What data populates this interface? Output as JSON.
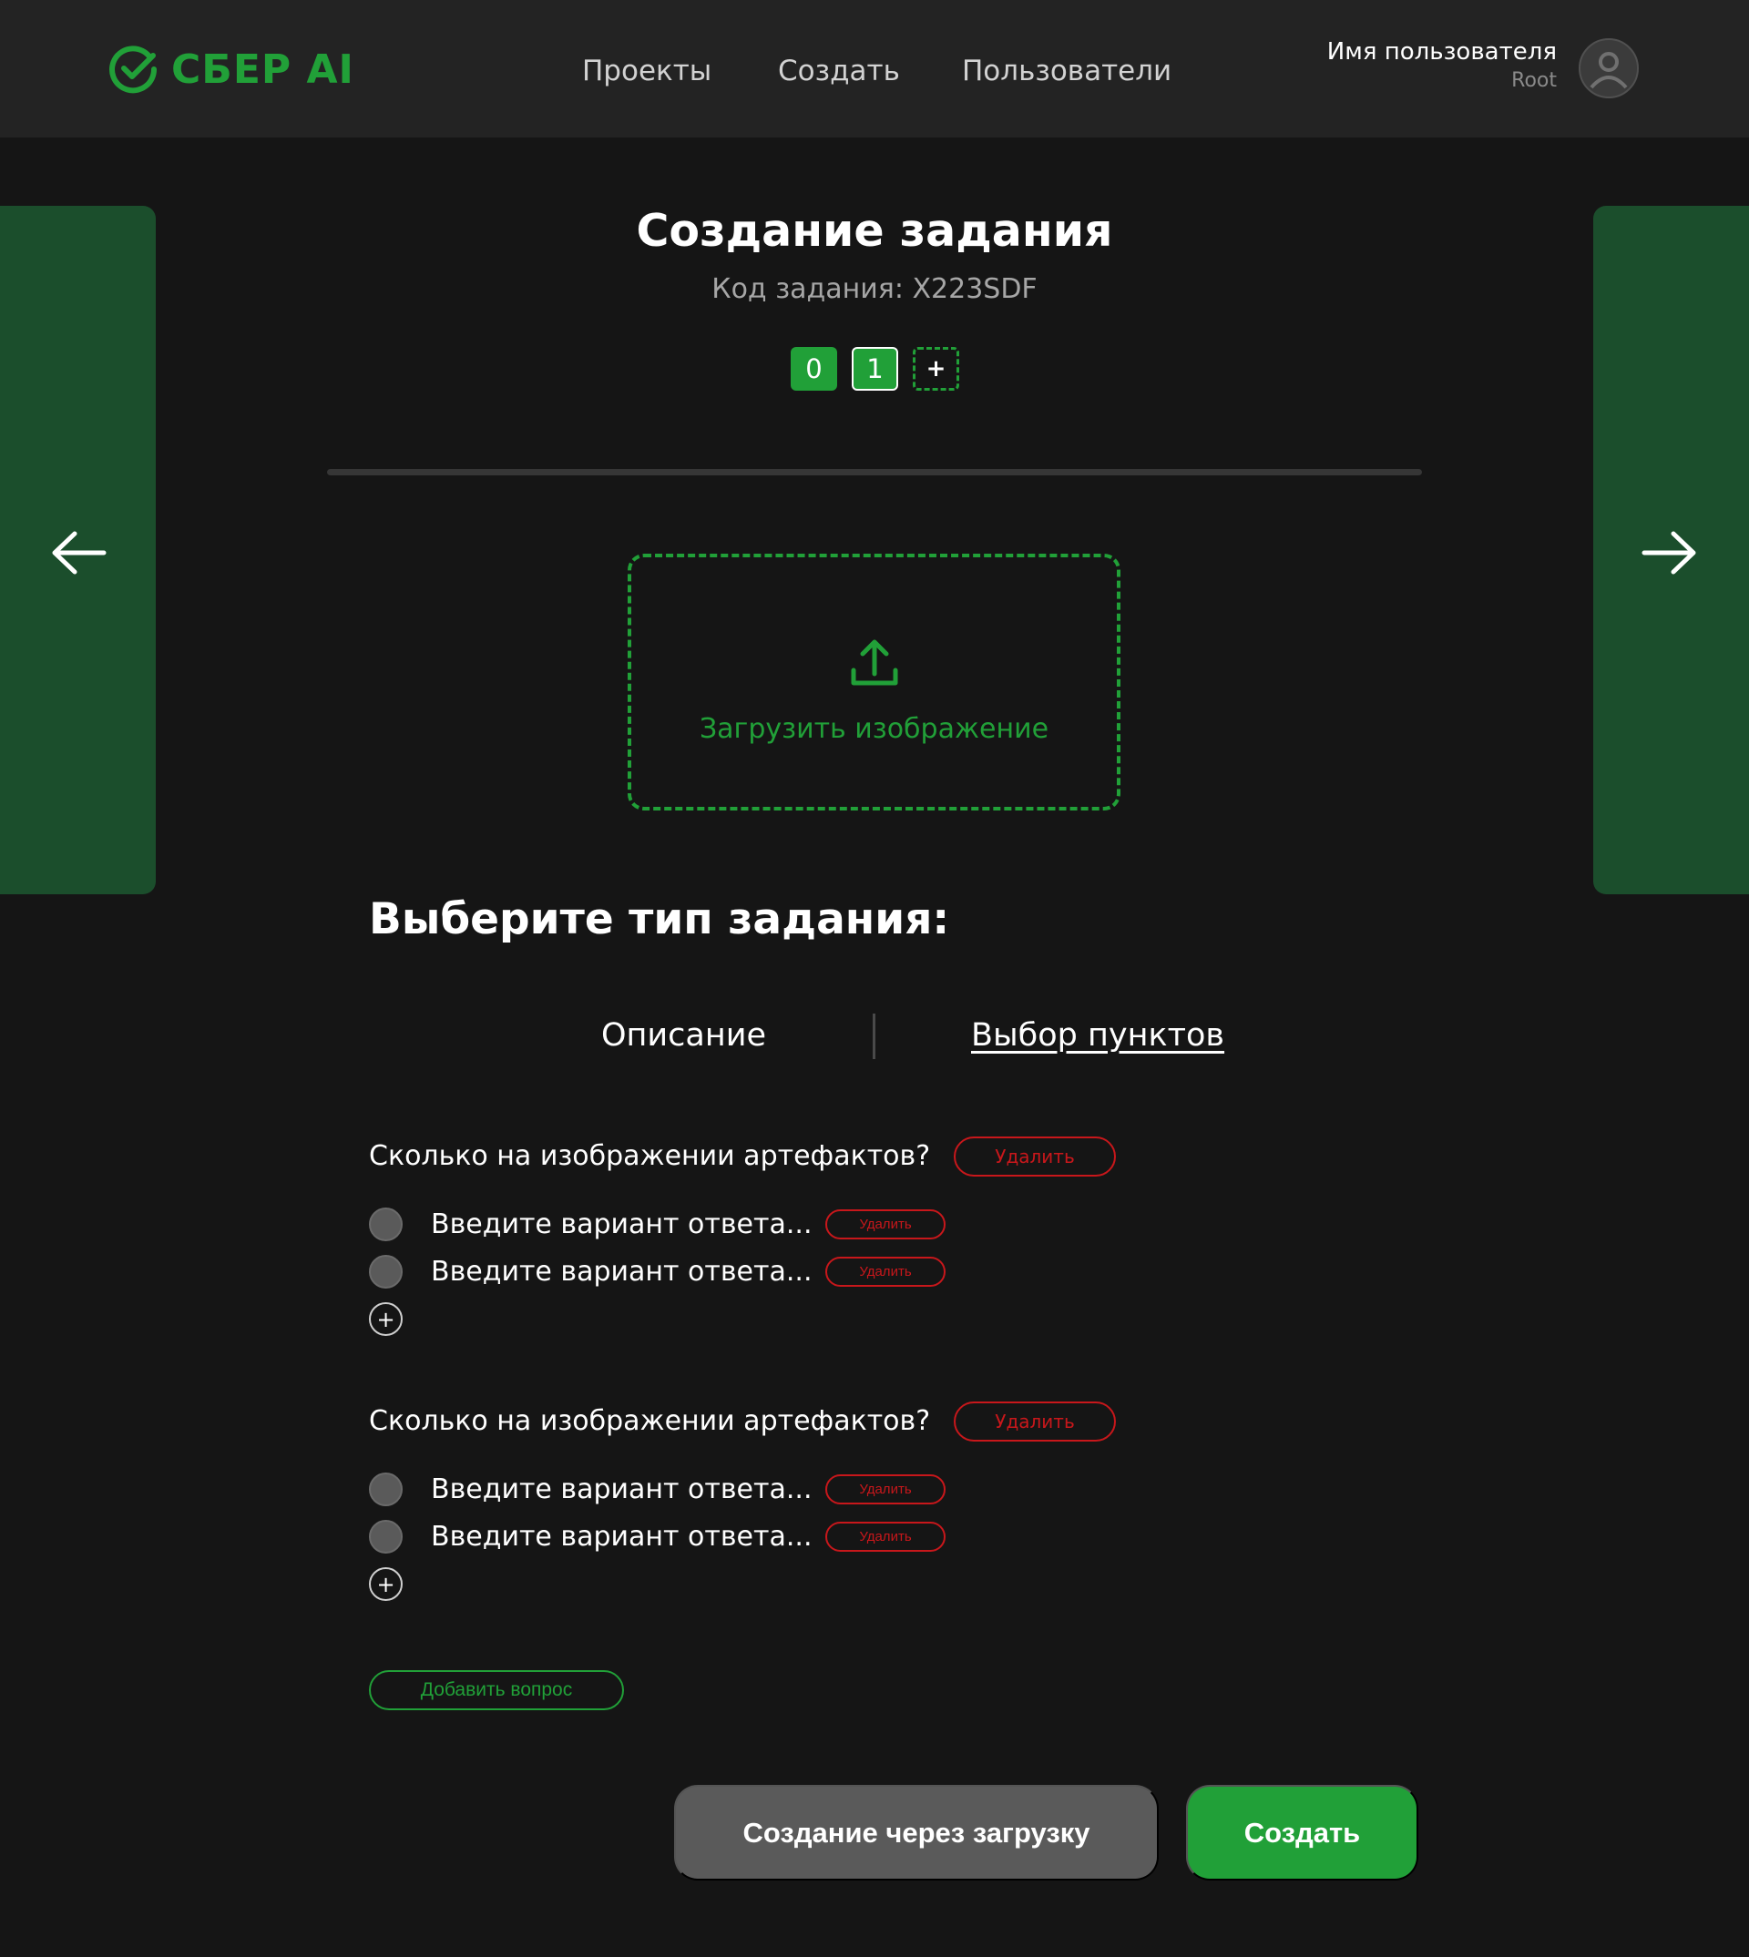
{
  "header": {
    "logo_text": "СБЕР AI",
    "nav": [
      "Проекты",
      "Создать",
      "Пользователи"
    ],
    "user_name": "Имя пользователя",
    "user_role": "Root"
  },
  "task": {
    "title": "Создание задания",
    "code": "Код задания: X223SDF",
    "steps": [
      "0",
      "1"
    ],
    "add_step": "+"
  },
  "upload": {
    "label": "Загрузить изображение"
  },
  "task_type": {
    "title": "Выберите тип задания:",
    "tabs": [
      "Описание",
      "Выбор пунктов"
    ],
    "selected_tab": "Выбор пунктов"
  },
  "questions": [
    {
      "text": "Сколько на изображении артефактов?",
      "delete_label": "Удалить",
      "options": [
        {
          "placeholder": "Введите вариант ответа...",
          "delete_label": "Удалить"
        },
        {
          "placeholder": "Введите вариант ответа...",
          "delete_label": "Удалить"
        }
      ],
      "add_option": "+"
    },
    {
      "text": "Сколько на изображении артефактов?",
      "delete_label": "Удалить",
      "options": [
        {
          "placeholder": "Введите вариант ответа...",
          "delete_label": "Удалить"
        },
        {
          "placeholder": "Введите вариант ответа...",
          "delete_label": "Удалить"
        }
      ],
      "add_option": "+"
    }
  ],
  "actions": {
    "add_question": "Добавить вопрос",
    "create_via_upload": "Создание через загрузку",
    "create": "Создать"
  },
  "colors": {
    "accent": "#21a038",
    "danger": "#c8171b",
    "background": "#151515",
    "header": "#232323",
    "side_panel": "#1b4e2c"
  },
  "icons": {
    "logo": "sber-check-icon",
    "avatar": "user-avatar-icon",
    "prev": "arrow-left-icon",
    "next": "arrow-right-icon",
    "upload": "upload-icon"
  }
}
